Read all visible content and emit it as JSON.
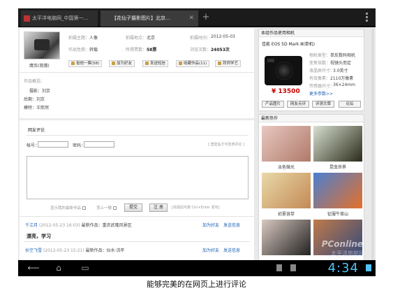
{
  "browser": {
    "tabs": [
      {
        "title": "太平洋电脑网_中国第一…"
      },
      {
        "title": "【花仙子摄影图片】北京…"
      }
    ],
    "new_tab": "+",
    "close": "✕"
  },
  "photo_info": {
    "caption": "鹰伟(简猜)",
    "rows": [
      [
        {
          "label": "拍摄主题：",
          "value": "人像"
        },
        {
          "label": "拍摄地点：",
          "value": "北京"
        },
        {
          "label": "拍摄时间：",
          "value": "2012-05-03"
        }
      ],
      [
        {
          "label": "作品性质：",
          "value": "转载"
        },
        {
          "label": "所得票数：",
          "value": "58票"
        },
        {
          "label": "浏览次数：",
          "value": "24053次"
        }
      ]
    ],
    "actions": [
      {
        "label": "投他一票(58)"
      },
      {
        "label": "加为好友"
      },
      {
        "label": "发送短信"
      },
      {
        "label": "收藏作品(11)"
      },
      {
        "label": "拜师学艺"
      }
    ]
  },
  "work_desc": {
    "title": "作品概括：",
    "lines": [
      "摄影：刘京",
      "后期：刘京",
      "模特：王熙然"
    ]
  },
  "comments": {
    "title": "网友评论",
    "account_label": "帐号：",
    "password_label": "密码：",
    "login_hint": "[ 登陆后才可发表评论 ]",
    "option1": "显示我的最新作品",
    "option2": "顶上一楼",
    "submit": "提交",
    "register": "注 册",
    "tip": "[完成后可按 Ctrl+Enter 发布]",
    "entries": [
      {
        "user": "千江月",
        "date": "(2012-05-23 16:03)",
        "latest_label": "最新作品：",
        "latest": "重庆武隆风景区",
        "add_friend": "加为好友",
        "send_msg": "发送信息",
        "text": "漂亮，学习"
      },
      {
        "user": "长空飞雪",
        "date": "(2012-05-23 15:21)",
        "latest_label": "最新作品：",
        "latest": "似水·流年",
        "add_friend": "加为好友",
        "send_msg": "发送信息",
        "text": ""
      }
    ]
  },
  "camera_box": {
    "title": "本组作品使用相机",
    "model": "佳能 EOS 5D Mark Ⅲ(单机)",
    "specs": [
      {
        "label": "相机类型：",
        "value": "单反数码相机"
      },
      {
        "label": "变焦倍数：",
        "value": "视镜头而定"
      },
      {
        "label": "液晶屏尺寸：",
        "value": "3.0英寸"
      },
      {
        "label": "有效像素：",
        "value": "2110万像素"
      },
      {
        "label": "传感器尺寸：",
        "value": "36×24mm"
      }
    ],
    "more": "更多参数>>",
    "price": "¥ 13500",
    "buttons": [
      "产品图片",
      "网友点评",
      "评测文章",
      "论坛"
    ]
  },
  "hot_box": {
    "title": "最新热作",
    "items": [
      {
        "caption": "淡色微光",
        "colors": [
          "#e8c8c0",
          "#b07a6a"
        ]
      },
      {
        "caption": "昆虫世界",
        "colors": [
          "#d8e0d0",
          "#2b2b1a"
        ]
      },
      {
        "caption": "初夏容芽",
        "colors": [
          "#e9d8a8",
          "#c28a55"
        ]
      },
      {
        "caption": "征服牛背山",
        "colors": [
          "#4a7fd1",
          "#e5702a"
        ]
      },
      {
        "caption": "",
        "colors": [
          "#d9c9c0",
          "#222222"
        ]
      },
      {
        "caption": "",
        "colors": [
          "#c07a4a",
          "#364a7a"
        ]
      }
    ]
  },
  "status_bar": {
    "nav": [
      "⟵",
      "⌂",
      "▭"
    ],
    "time": "4:34",
    "watermark": "PConline",
    "watermark_sub": "太平洋电脑网"
  },
  "caption": "能够完美的在网页上进行评论"
}
